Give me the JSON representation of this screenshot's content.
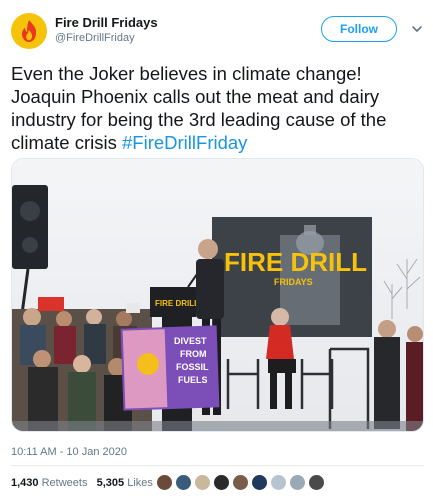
{
  "account": {
    "display_name": "Fire Drill Fridays",
    "handle": "@FireDrillFriday",
    "avatar_icon": "flame-logo-icon",
    "avatar_color": "#f6c20a"
  },
  "follow_button": {
    "label": "Follow",
    "color": "#1da1f2"
  },
  "menu": {
    "icon": "chevron-down-icon"
  },
  "tweet": {
    "text": "Even the Joker believes in climate change! Joaquin Phoenix calls out the meat and dairy industry for being the 3rd leading cause of the climate crisis ",
    "hashtag": "#FireDrillFriday"
  },
  "media": {
    "podium_sign": "FIRE DRILL",
    "poster_text": [
      "DIVEST",
      "FROM",
      "FOSSIL",
      "FUELS"
    ],
    "banner_text": "FIRE DRILL",
    "banner_subtext": "FRIDAYS"
  },
  "timestamp": "10:11 AM - 10 Jan 2020",
  "stats": {
    "retweets_count": "1,430",
    "retweets_label": "Retweets",
    "likes_count": "5,305",
    "likes_label": "Likes"
  },
  "likers": [
    {
      "icon": "user-avatar-icon",
      "color": "#6b4a3a"
    },
    {
      "icon": "user-avatar-icon",
      "color": "#3b5b7a"
    },
    {
      "icon": "user-avatar-icon",
      "color": "#c9b89c"
    },
    {
      "icon": "user-avatar-icon",
      "color": "#2a2a2a"
    },
    {
      "icon": "user-avatar-icon",
      "color": "#7a5c4b"
    },
    {
      "icon": "user-avatar-icon",
      "color": "#1f3a5c"
    },
    {
      "icon": "user-avatar-icon",
      "color": "#b7c4cf"
    },
    {
      "icon": "user-avatar-icon",
      "color": "#9aa9b5"
    },
    {
      "icon": "user-avatar-icon",
      "color": "#4a4a4a"
    }
  ]
}
